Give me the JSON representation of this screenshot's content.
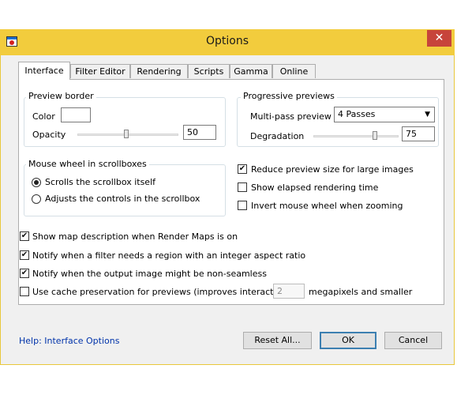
{
  "window": {
    "title": "Options",
    "close_glyph": "✕"
  },
  "tabs": [
    "Interface",
    "Filter Editor",
    "Rendering",
    "Scripts",
    "Gamma",
    "Online"
  ],
  "preview_border": {
    "title": "Preview border",
    "color_label": "Color",
    "opacity_label": "Opacity",
    "opacity_value": "50"
  },
  "progressive_previews": {
    "title": "Progressive previews",
    "multipass_label": "Multi-pass preview",
    "multipass_value": "4 Passes",
    "degradation_label": "Degradation",
    "degradation_value": "75"
  },
  "mouse_wheel": {
    "title": "Mouse wheel in scrollboxes",
    "option1": "Scrolls the scrollbox itself",
    "option2": "Adjusts the controls in the scrollbox",
    "selected": 1
  },
  "right_checks": [
    {
      "label": "Reduce preview size for large images",
      "checked": true
    },
    {
      "label": "Show elapsed rendering time",
      "checked": false
    },
    {
      "label": "Invert mouse wheel when zooming",
      "checked": false
    }
  ],
  "bottom_checks": [
    {
      "label": "Show map description when Render Maps is on",
      "checked": true
    },
    {
      "label": "Notify when a filter needs a region with an integer aspect ratio",
      "checked": true
    },
    {
      "label": "Notify when the output image might be non-seamless",
      "checked": true
    }
  ],
  "cache": {
    "label": "Use cache preservation for previews (improves interactivity):",
    "value": "2",
    "suffix": "megapixels and smaller",
    "checked": false
  },
  "footer": {
    "help_link": "Help: Interface Options",
    "reset_label": "Reset All...",
    "ok_label": "OK",
    "cancel_label": "Cancel"
  },
  "colors": {
    "titlebar": "#f2cc3d",
    "close": "#c7443b",
    "link": "#0033aa"
  },
  "icons": {
    "app": "app-icon",
    "close": "close-icon",
    "dropdown": "chevron-down-icon",
    "check": "checkmark-icon"
  }
}
